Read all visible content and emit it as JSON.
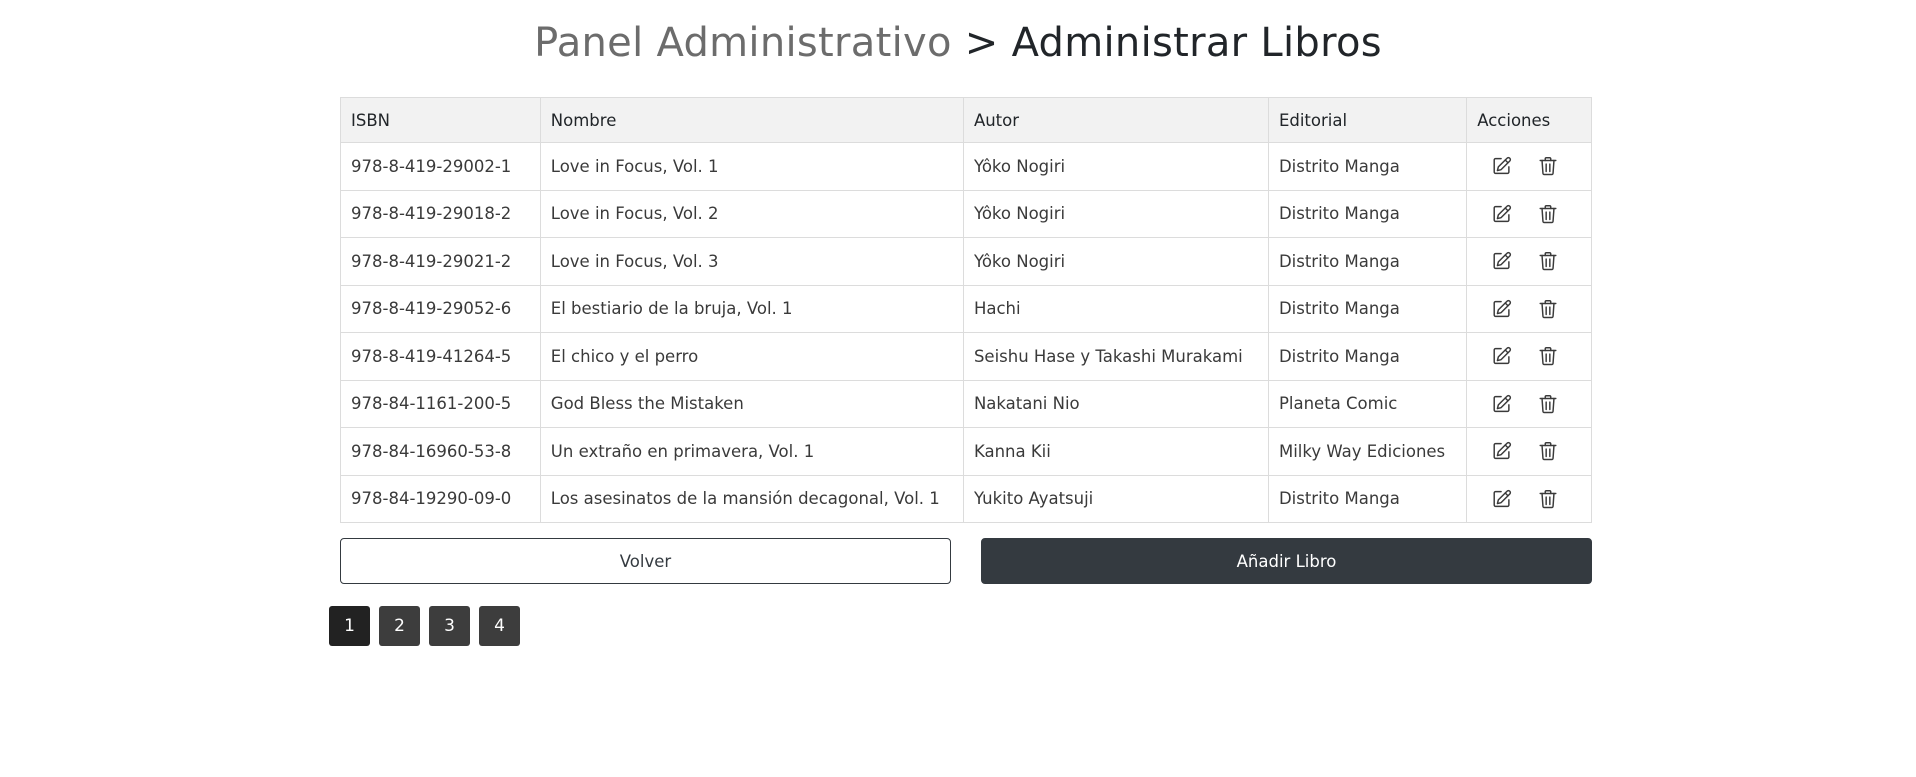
{
  "header": {
    "crumb": "Panel Administrativo",
    "separator": ">",
    "current": "Administrar Libros"
  },
  "table": {
    "columns": [
      "ISBN",
      "Nombre",
      "Autor",
      "Editorial",
      "Acciones"
    ],
    "rows": [
      {
        "isbn": "978-8-419-29002-1",
        "nombre": "Love in Focus, Vol. 1",
        "autor": "Yôko Nogiri",
        "editorial": "Distrito Manga"
      },
      {
        "isbn": "978-8-419-29018-2",
        "nombre": "Love in Focus, Vol. 2",
        "autor": "Yôko Nogiri",
        "editorial": "Distrito Manga"
      },
      {
        "isbn": "978-8-419-29021-2",
        "nombre": "Love in Focus, Vol. 3",
        "autor": "Yôko Nogiri",
        "editorial": "Distrito Manga"
      },
      {
        "isbn": "978-8-419-29052-6",
        "nombre": "El bestiario de la bruja, Vol. 1",
        "autor": "Hachi",
        "editorial": "Distrito Manga"
      },
      {
        "isbn": "978-8-419-41264-5",
        "nombre": "El chico y el perro",
        "autor": "Seishu Hase y Takashi Murakami",
        "editorial": "Distrito Manga"
      },
      {
        "isbn": "978-84-1161-200-5",
        "nombre": "God Bless the Mistaken",
        "autor": "Nakatani Nio",
        "editorial": "Planeta Comic"
      },
      {
        "isbn": "978-84-16960-53-8",
        "nombre": "Un extraño en primavera, Vol. 1",
        "autor": "Kanna Kii",
        "editorial": "Milky Way Ediciones"
      },
      {
        "isbn": "978-84-19290-09-0",
        "nombre": "Los asesinatos de la mansión decagonal, Vol. 1",
        "autor": "Yukito Ayatsuji",
        "editorial": "Distrito Manga"
      }
    ],
    "row_actions": [
      "edit-icon",
      "trash-icon"
    ]
  },
  "buttons": {
    "back_label": "Volver",
    "add_label": "Añadir Libro"
  },
  "pagination": {
    "pages": [
      "1",
      "2",
      "3",
      "4"
    ],
    "active": "1"
  },
  "colors": {
    "dark": "#343a40",
    "page_active": "#222222",
    "page_inactive": "#3d3d3d",
    "header_bg": "#f2f2f2"
  }
}
